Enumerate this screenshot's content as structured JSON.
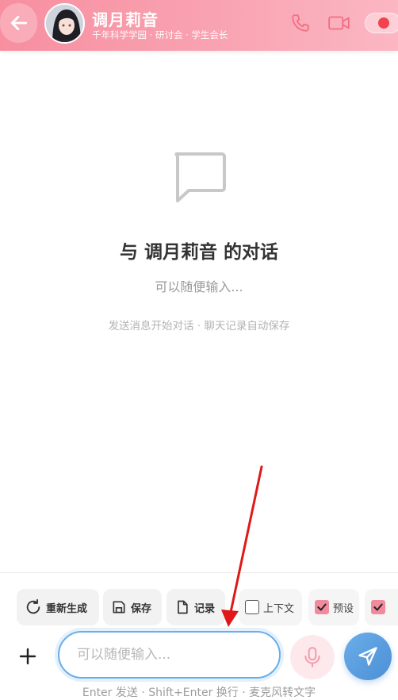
{
  "header": {
    "back_icon": "arrow-left-icon",
    "avatar_icon": "character-avatar",
    "name": "调月莉音",
    "subtitle": "千年科学学园 · 研讨会 · 学生会长",
    "phone_icon": "phone-icon",
    "video_icon": "video-camera-icon",
    "toggle_state": "on",
    "accent_color": "#f78fa0",
    "toggle_dot_color": "#f0424f"
  },
  "empty_state": {
    "icon": "chat-bubble-icon",
    "title": "与 调月莉音 的对话",
    "subtitle": "可以随便输入...",
    "hint": "发送消息开始对话 · 聊天记录自动保存"
  },
  "toolbar": {
    "regenerate_label": "重新生成",
    "regenerate_icon": "refresh-icon",
    "save_label": "保存",
    "save_icon": "save-icon",
    "records_label": "记录",
    "records_icon": "document-icon",
    "checkboxes": [
      {
        "label": "上下文",
        "checked": false
      },
      {
        "label": "预设",
        "checked": true
      },
      {
        "label": "",
        "checked": true
      }
    ]
  },
  "composer": {
    "plus_icon": "plus-icon",
    "input_placeholder": "可以随便输入...",
    "input_value": "",
    "mic_icon": "microphone-icon",
    "send_icon": "send-icon",
    "send_color": "#5b9de0",
    "footer_hint": "Enter 发送 · Shift+Enter 换行 · 麦克风转文字"
  }
}
